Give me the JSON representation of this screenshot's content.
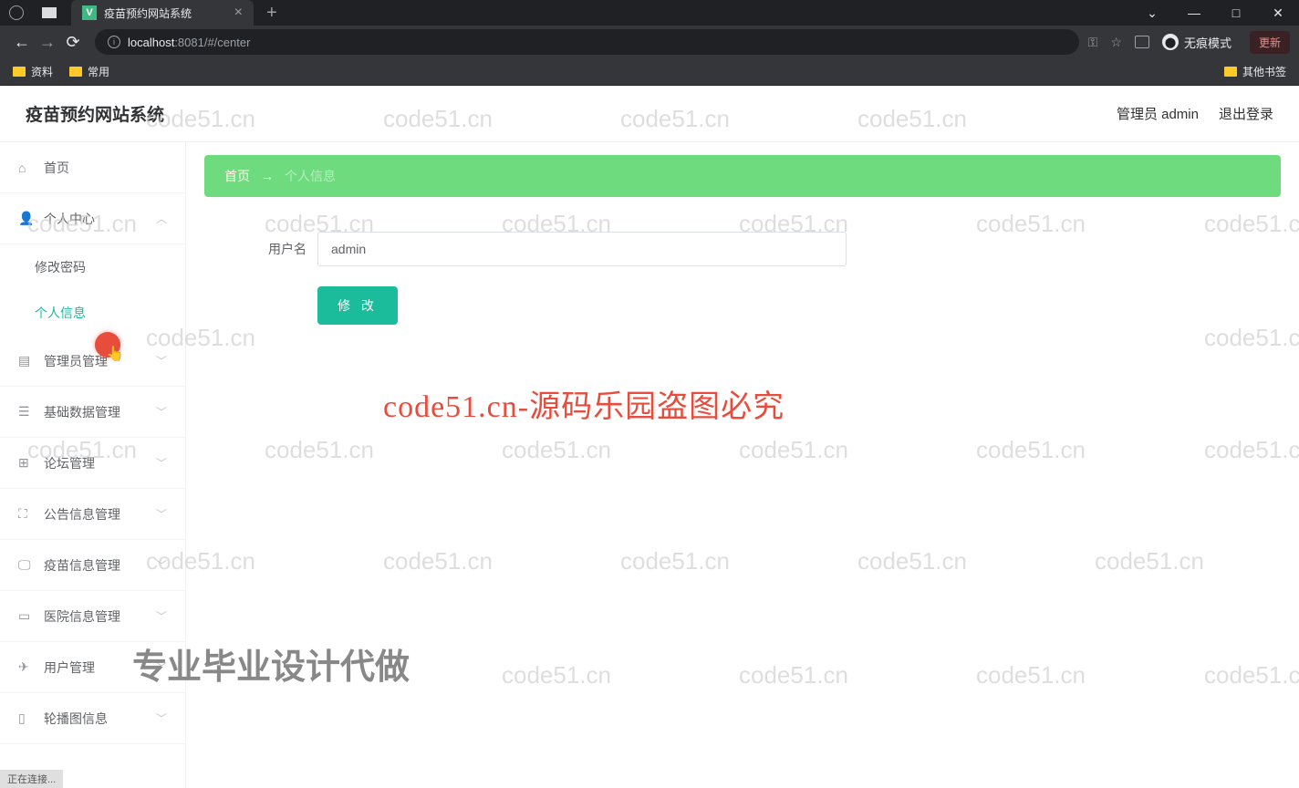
{
  "browser": {
    "tab_title": "疫苗预约网站系统",
    "new_tab": "+",
    "close_tab": "×",
    "favicon": "V",
    "url_host": "localhost",
    "url_port_path": ":8081/#/center",
    "incognito_label": "无痕模式",
    "update_label": "更新",
    "chevron": "⌄",
    "minimize": "—",
    "maximize": "□",
    "close": "✕"
  },
  "bookmarks": {
    "item1": "资料",
    "item2": "常用",
    "other": "其他书签"
  },
  "header": {
    "title": "疫苗预约网站系统",
    "user_label": "管理员 admin",
    "logout": "退出登录"
  },
  "sidebar": {
    "home": "首页",
    "personal_center": "个人中心",
    "change_password": "修改密码",
    "personal_info": "个人信息",
    "admin_mgmt": "管理员管理",
    "base_data_mgmt": "基础数据管理",
    "forum_mgmt": "论坛管理",
    "notice_mgmt": "公告信息管理",
    "vaccine_mgmt": "疫苗信息管理",
    "hospital_mgmt": "医院信息管理",
    "user_mgmt": "用户管理",
    "carousel_mgmt": "轮播图信息"
  },
  "breadcrumb": {
    "home": "首页",
    "arrow": "→",
    "current": "个人信息"
  },
  "form": {
    "username_label": "用户名",
    "username_value": "admin",
    "submit": "修 改"
  },
  "watermark": {
    "text": "code51.cn",
    "red": "code51.cn-源码乐园盗图必究",
    "gray": "专业毕业设计代做"
  },
  "status": "正在连接..."
}
